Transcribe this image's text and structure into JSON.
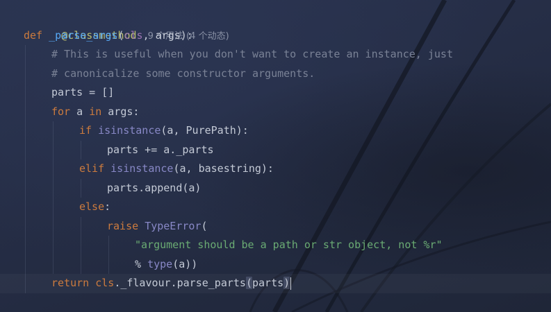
{
  "editor": {
    "language": "python",
    "code_lens_hint": "9 个用法 (4 个动态)",
    "lines": [
      {
        "tokens": [
          "@classmethod"
        ]
      },
      {
        "tokens": [
          "def",
          " ",
          "_parse_args",
          "(",
          "cls",
          ", ",
          "args",
          "):"
        ]
      },
      {
        "tokens": [
          "# This is useful when you don't want to create an instance, just"
        ]
      },
      {
        "tokens": [
          "# canonicalize some constructor arguments."
        ]
      },
      {
        "tokens": [
          "parts = []"
        ]
      },
      {
        "tokens": [
          "for",
          " a ",
          "in",
          " args:"
        ]
      },
      {
        "tokens": [
          "if",
          " ",
          "isinstance",
          "(a, PurePath):"
        ]
      },
      {
        "tokens": [
          "parts += a._parts"
        ]
      },
      {
        "tokens": [
          "elif",
          " ",
          "isinstance",
          "(a, basestring):"
        ]
      },
      {
        "tokens": [
          "parts.append(a)"
        ]
      },
      {
        "tokens": [
          "else",
          ":"
        ]
      },
      {
        "tokens": [
          "raise",
          " ",
          "TypeError",
          "("
        ]
      },
      {
        "tokens": [
          "\"argument should be a path or str object, not %r\""
        ]
      },
      {
        "tokens": [
          "% ",
          "type",
          "(a))"
        ]
      },
      {
        "tokens": [
          "return",
          " ",
          "cls",
          "._flavour.parse_parts",
          "(",
          "parts",
          ")"
        ]
      }
    ]
  },
  "colors": {
    "background": "#232b40",
    "keyword": "#cc7b3e",
    "function": "#56a8f5",
    "self": "#9a74b3",
    "builtin": "#8888c6",
    "comment": "#7a8296",
    "string": "#6aab73",
    "decorator": "#bcbf6e"
  }
}
